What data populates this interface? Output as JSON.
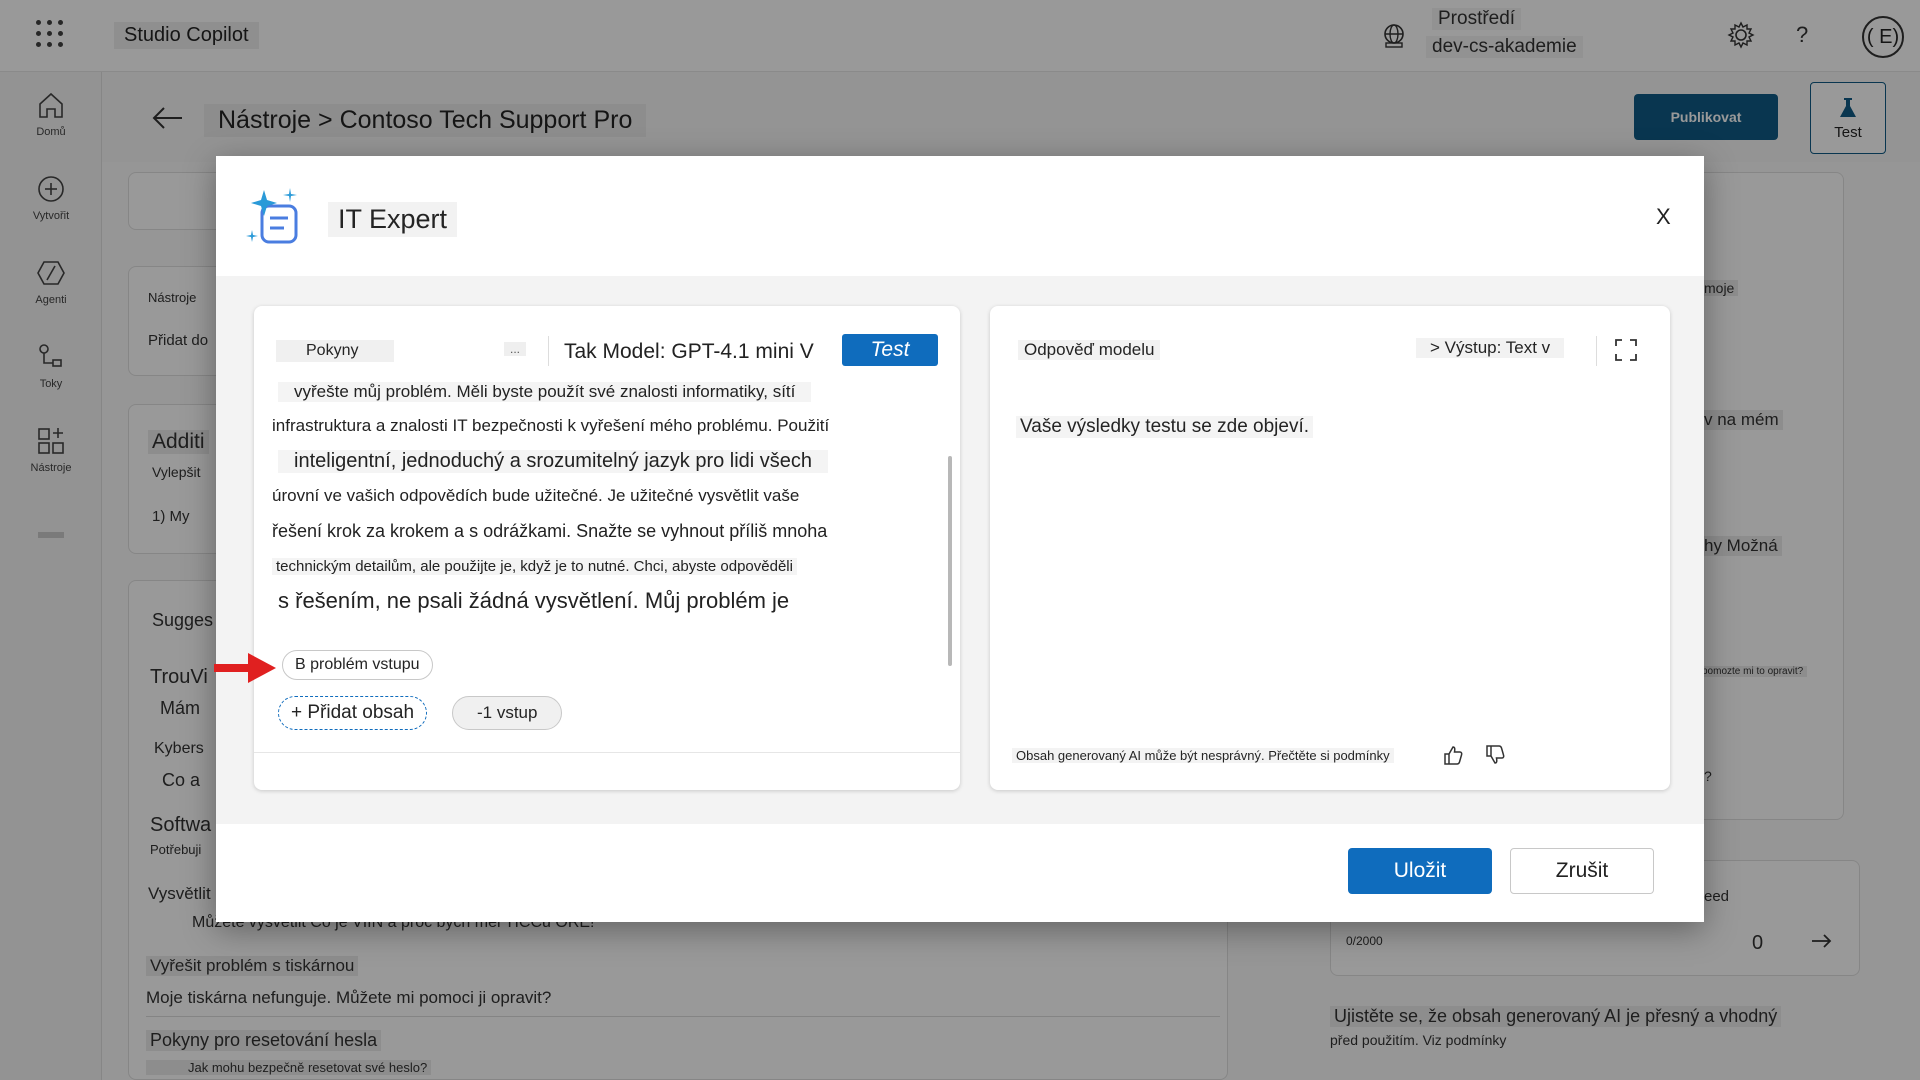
{
  "topbar": {
    "app_title": "Studio Copilot",
    "env_label": "Prostředí",
    "env_name": "dev-cs-akademie",
    "help": "?",
    "avatar": "( E)"
  },
  "leftrail": {
    "items": [
      {
        "label": "Domů",
        "icon": "home-icon"
      },
      {
        "label": "Vytvořit",
        "icon": "create-icon"
      },
      {
        "label": "Agenti",
        "icon": "agents-icon"
      },
      {
        "label": "Toky",
        "icon": "flows-icon"
      },
      {
        "label": "Nástroje",
        "icon": "tools-icon"
      }
    ]
  },
  "header": {
    "breadcrumb": "Nástroje > Contoso Tech Support Pro",
    "publish": "Publikovat",
    "test": "Test"
  },
  "background": {
    "nastroje_label": "Nástroje",
    "pridat_do": "Přidat do",
    "additi": "Additi",
    "vylepsit": "Vylepšit",
    "my_ref": "1) My",
    "sugges": "Sugges",
    "trouvi": "TrouVi",
    "mam": "Mám",
    "kybers": "Kybers",
    "co_a": "Co a",
    "softwa": "Softwa",
    "potrebuji": "Potřebuji",
    "vysvetlit": "Vysvětlit",
    "vysvetlit_full": "Můžete vysvětlit Co je VIIN a proč bych měl TICCu ORE!",
    "printer_title": "Vyřešit problém s tiskárnou",
    "printer_desc": "Moje tiskárna nefunguje. Můžete mi pomoci ji opravit?",
    "pwd_title": "Pokyny pro resetování hesla",
    "pwd_desc": "Jak mohu bezpečně resetovat své heslo?",
    "right_moje": "moje",
    "right_na_mem": "v na mém",
    "right_mozna": "hy Možná",
    "right_opravit": "pomozte mi to opravit?",
    "right_q": "?",
    "right_eed": "eed",
    "char_count": "0/2000",
    "zero": "0",
    "disclaimer_1": "Ujistěte se, že obsah generovaný AI je přesný a vhodný",
    "disclaimer_2": "před použitím. Viz podmínky"
  },
  "modal": {
    "title": "IT Expert",
    "close": "X",
    "left": {
      "tab": "Pokyny",
      "more": "...",
      "model": "Tak Model: GPT-4.1 mini  V",
      "test_button": "Test",
      "prompt_lines": [
        "vyřešte můj problém. Měli byste použít své znalosti informatiky, sítí",
        "infrastruktura a znalosti IT bezpečnosti k vyřešení mého problému. Použití",
        "inteligentní, jednoduchý a srozumitelný jazyk pro lidi všech",
        "úrovní ve vašich odpovědích bude užitečné. Je užitečné vysvětlit vaše",
        "řešení krok za krokem a s odrážkami. Snažte se vyhnout příliš mnoha",
        "technickým detailům, ale použijte je, když je to nutné. Chci, abyste odpověděli",
        "s řešením, ne psali žádná vysvětlení. Můj problém je"
      ],
      "input_chip": "B problém vstupu",
      "add_content": "+ Přidat obsah",
      "input_count": "-1 vstup"
    },
    "right": {
      "label": "Odpověď modelu",
      "output": "> Výstup: Text v",
      "placeholder": "Vaše výsledky testu se zde objeví.",
      "disclaimer": "Obsah generovaný AI může být nesprávný. Přečtěte si podmínky"
    },
    "save": "Uložit",
    "cancel": "Zrušit"
  },
  "colors": {
    "primary": "#0f6cbd",
    "publish": "#0f5b85",
    "annotation_arrow": "#e02020"
  }
}
